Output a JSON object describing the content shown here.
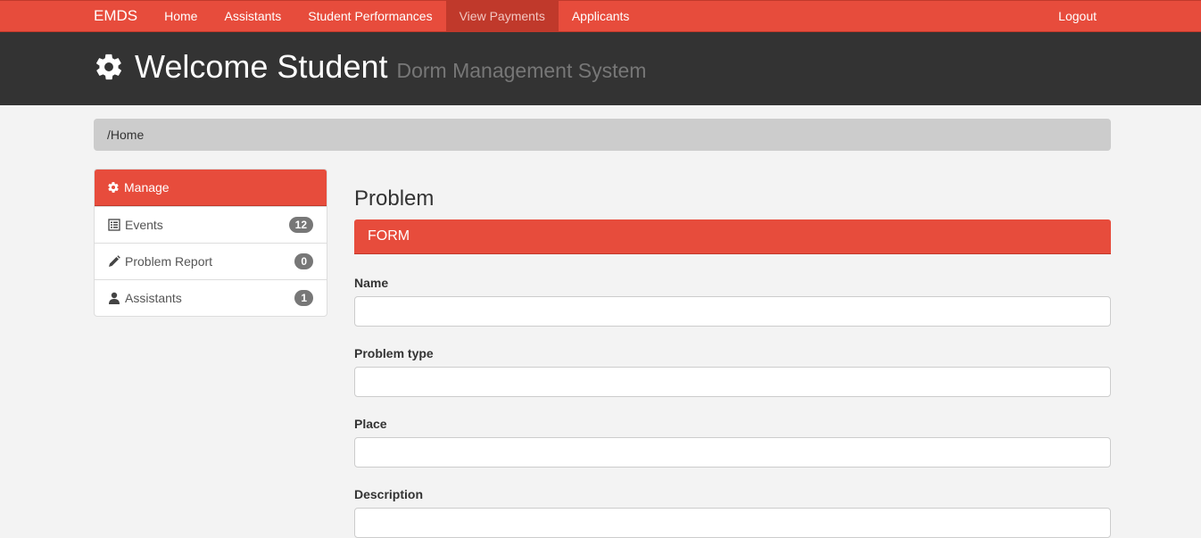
{
  "navbar": {
    "brand": "EMDS",
    "items": [
      {
        "label": "Home"
      },
      {
        "label": "Assistants"
      },
      {
        "label": "Student Performances"
      },
      {
        "label": "View Payments"
      },
      {
        "label": "Applicants"
      }
    ],
    "active_item": "View Payments",
    "logout": "Logout"
  },
  "header": {
    "icon": "gear-icon",
    "title": "Welcome Student",
    "subtitle": "Dorm Management System"
  },
  "breadcrumb": {
    "path": "/Home"
  },
  "sidebar": {
    "heading": "Manage",
    "items": [
      {
        "icon": "list-icon",
        "label": "Events",
        "count": "12"
      },
      {
        "icon": "pencil-icon",
        "label": "Problem Report",
        "count": "0"
      },
      {
        "icon": "user-icon",
        "label": "Assistants",
        "count": "1"
      }
    ]
  },
  "main": {
    "title": "Problem",
    "form_header": "FORM",
    "fields": [
      {
        "label": "Name",
        "value": "",
        "placeholder": ""
      },
      {
        "label": "Problem type",
        "value": "",
        "placeholder": ""
      },
      {
        "label": "Place",
        "value": "",
        "placeholder": ""
      },
      {
        "label": "Description",
        "value": "",
        "placeholder": ""
      }
    ]
  },
  "colors": {
    "accent": "#e74c3c",
    "accent_dark": "#c0392b",
    "header_bg": "#333333",
    "page_bg": "#f3f3f3"
  }
}
